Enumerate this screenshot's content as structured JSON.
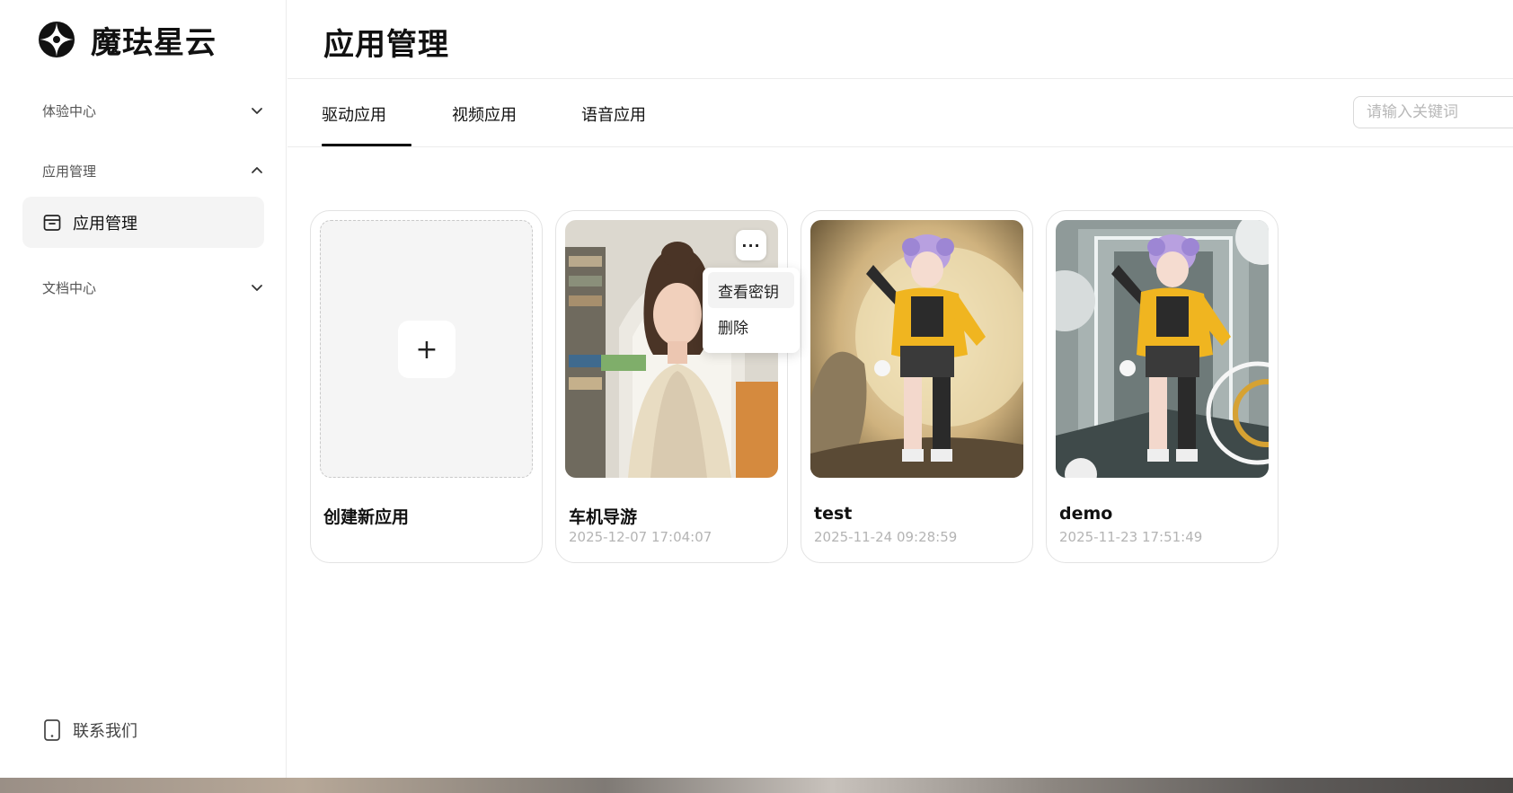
{
  "brand": {
    "name": "魔珐星云",
    "logo_icon": "brand-logo-icon"
  },
  "sidebar": {
    "groups": [
      {
        "label": "体验中心",
        "expanded": false
      },
      {
        "label": "应用管理",
        "expanded": true
      },
      {
        "label": "文档中心",
        "expanded": false
      }
    ],
    "active_item": {
      "label": "应用管理",
      "icon": "box-icon"
    },
    "contact": {
      "label": "联系我们",
      "icon": "phone-icon"
    }
  },
  "header": {
    "title": "应用管理"
  },
  "tabs": [
    {
      "label": "驱动应用",
      "active": true
    },
    {
      "label": "视频应用",
      "active": false
    },
    {
      "label": "语音应用",
      "active": false
    }
  ],
  "search": {
    "placeholder": "请输入关键词",
    "value": ""
  },
  "create_card": {
    "label": "创建新应用",
    "plus": "+"
  },
  "cards": [
    {
      "title": "车机导游",
      "date": "2025-12-07 17:04:07"
    },
    {
      "title": "test",
      "date": "2025-11-24 09:28:59"
    },
    {
      "title": "demo",
      "date": "2025-11-23 17:51:49"
    }
  ],
  "more_menu": {
    "button": "···",
    "items": [
      {
        "label": "查看密钥"
      },
      {
        "label": "删除"
      }
    ]
  },
  "colors": {
    "accent": "#111111",
    "muted": "#b4b4b4",
    "border": "#e3e3e3"
  }
}
